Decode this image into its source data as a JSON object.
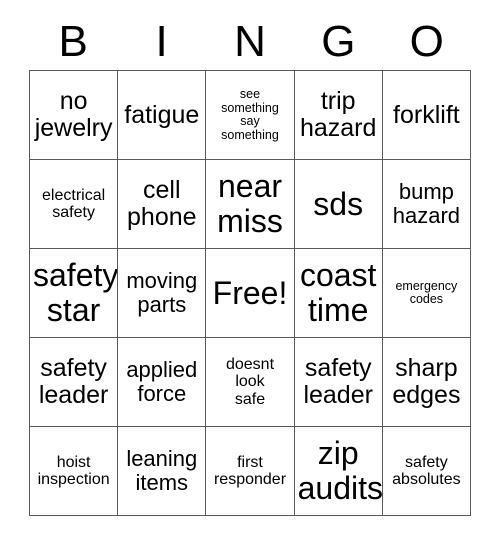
{
  "card": {
    "title": "BINGO",
    "header_letters": [
      "B",
      "I",
      "N",
      "G",
      "O"
    ],
    "free_space_label": "Free!",
    "rows": [
      [
        {
          "text": "no\njewelry",
          "size": "lg"
        },
        {
          "text": "fatigue",
          "size": "lg"
        },
        {
          "text": "see\nsomething\nsay\nsomething",
          "size": "xs"
        },
        {
          "text": "trip\nhazard",
          "size": "lg"
        },
        {
          "text": "forklift",
          "size": "lg"
        }
      ],
      [
        {
          "text": "electrical\nsafety",
          "size": "sm"
        },
        {
          "text": "cell\nphone",
          "size": "lg"
        },
        {
          "text": "near\nmiss",
          "size": "xl"
        },
        {
          "text": "sds",
          "size": "xl"
        },
        {
          "text": "bump\nhazard",
          "size": "md"
        }
      ],
      [
        {
          "text": "safety\nstar",
          "size": "xl"
        },
        {
          "text": "moving\nparts",
          "size": "md"
        },
        {
          "text": "Free!",
          "size": "xl"
        },
        {
          "text": "coast\ntime",
          "size": "xl"
        },
        {
          "text": "emergency\ncodes",
          "size": "xs"
        }
      ],
      [
        {
          "text": "safety\nleader",
          "size": "lg"
        },
        {
          "text": "applied\nforce",
          "size": "md"
        },
        {
          "text": "doesnt\nlook\nsafe",
          "size": "sm"
        },
        {
          "text": "safety\nleader",
          "size": "lg"
        },
        {
          "text": "sharp\nedges",
          "size": "lg"
        }
      ],
      [
        {
          "text": "hoist\ninspection",
          "size": "sm"
        },
        {
          "text": "leaning\nitems",
          "size": "md"
        },
        {
          "text": "first\nresponder",
          "size": "sm"
        },
        {
          "text": "zip\naudits",
          "size": "xl"
        },
        {
          "text": "safety\nabsolutes",
          "size": "sm"
        }
      ]
    ]
  },
  "colors": {
    "background": "#ffffff",
    "text": "#000000",
    "grid_line": "#5a5a5a"
  }
}
